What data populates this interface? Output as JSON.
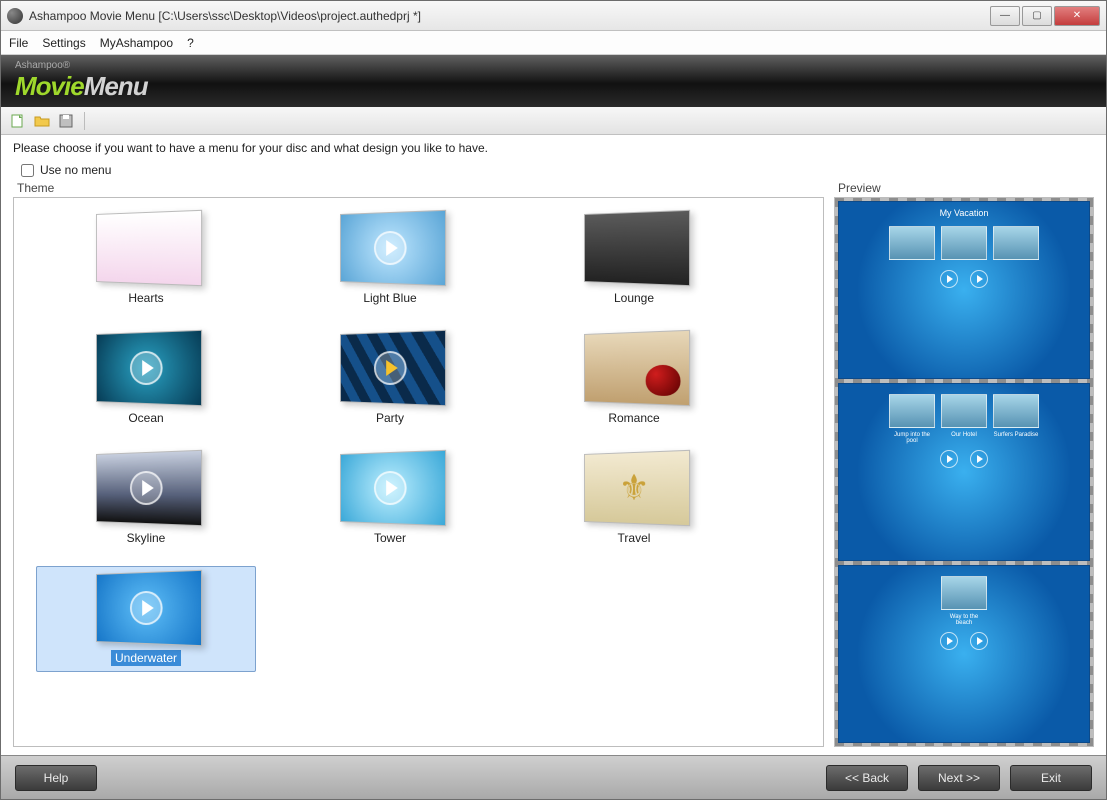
{
  "window": {
    "title": "Ashampoo Movie Menu [C:\\Users\\ssc\\Desktop\\Videos\\project.authedprj *]"
  },
  "menubar": {
    "items": [
      "File",
      "Settings",
      "MyAshampoo",
      "?"
    ]
  },
  "brand": {
    "sup": "Ashampoo®",
    "part1": "Movie",
    "part2": "Menu"
  },
  "instruction": "Please choose if you want to have a menu for your disc and what design you like to have.",
  "use_no_menu_label": "Use no menu",
  "theme_label": "Theme",
  "preview_label": "Preview",
  "themes": [
    {
      "name": "Hearts",
      "cls": "t-hearts",
      "play": false
    },
    {
      "name": "Light Blue",
      "cls": "t-lightblue",
      "play": true
    },
    {
      "name": "Lounge",
      "cls": "t-lounge",
      "play": false
    },
    {
      "name": "Ocean",
      "cls": "t-ocean",
      "play": true
    },
    {
      "name": "Party",
      "cls": "t-party",
      "play": true,
      "yellow": true
    },
    {
      "name": "Romance",
      "cls": "t-romance",
      "play": false
    },
    {
      "name": "Skyline",
      "cls": "t-skyline",
      "play": true
    },
    {
      "name": "Tower",
      "cls": "t-tower",
      "play": true
    },
    {
      "name": "Travel",
      "cls": "t-travel",
      "play": false
    },
    {
      "name": "Underwater",
      "cls": "t-underwater",
      "play": true,
      "selected": true
    }
  ],
  "preview": {
    "slides": [
      {
        "title": "My Vacation",
        "labels": [],
        "thumbs": 3,
        "ctrl": "play-back"
      },
      {
        "title": "",
        "labels": [
          "Jump into the pool",
          "Our Hotel",
          "Surfers Paradise"
        ],
        "thumbs": 3,
        "ctrl": "back-play"
      },
      {
        "title": "",
        "labels": [
          "Way to the beach"
        ],
        "thumbs": 1,
        "ctrl": "prev-play"
      }
    ]
  },
  "footer": {
    "help": "Help",
    "back": "<< Back",
    "next": "Next >>",
    "exit": "Exit"
  }
}
